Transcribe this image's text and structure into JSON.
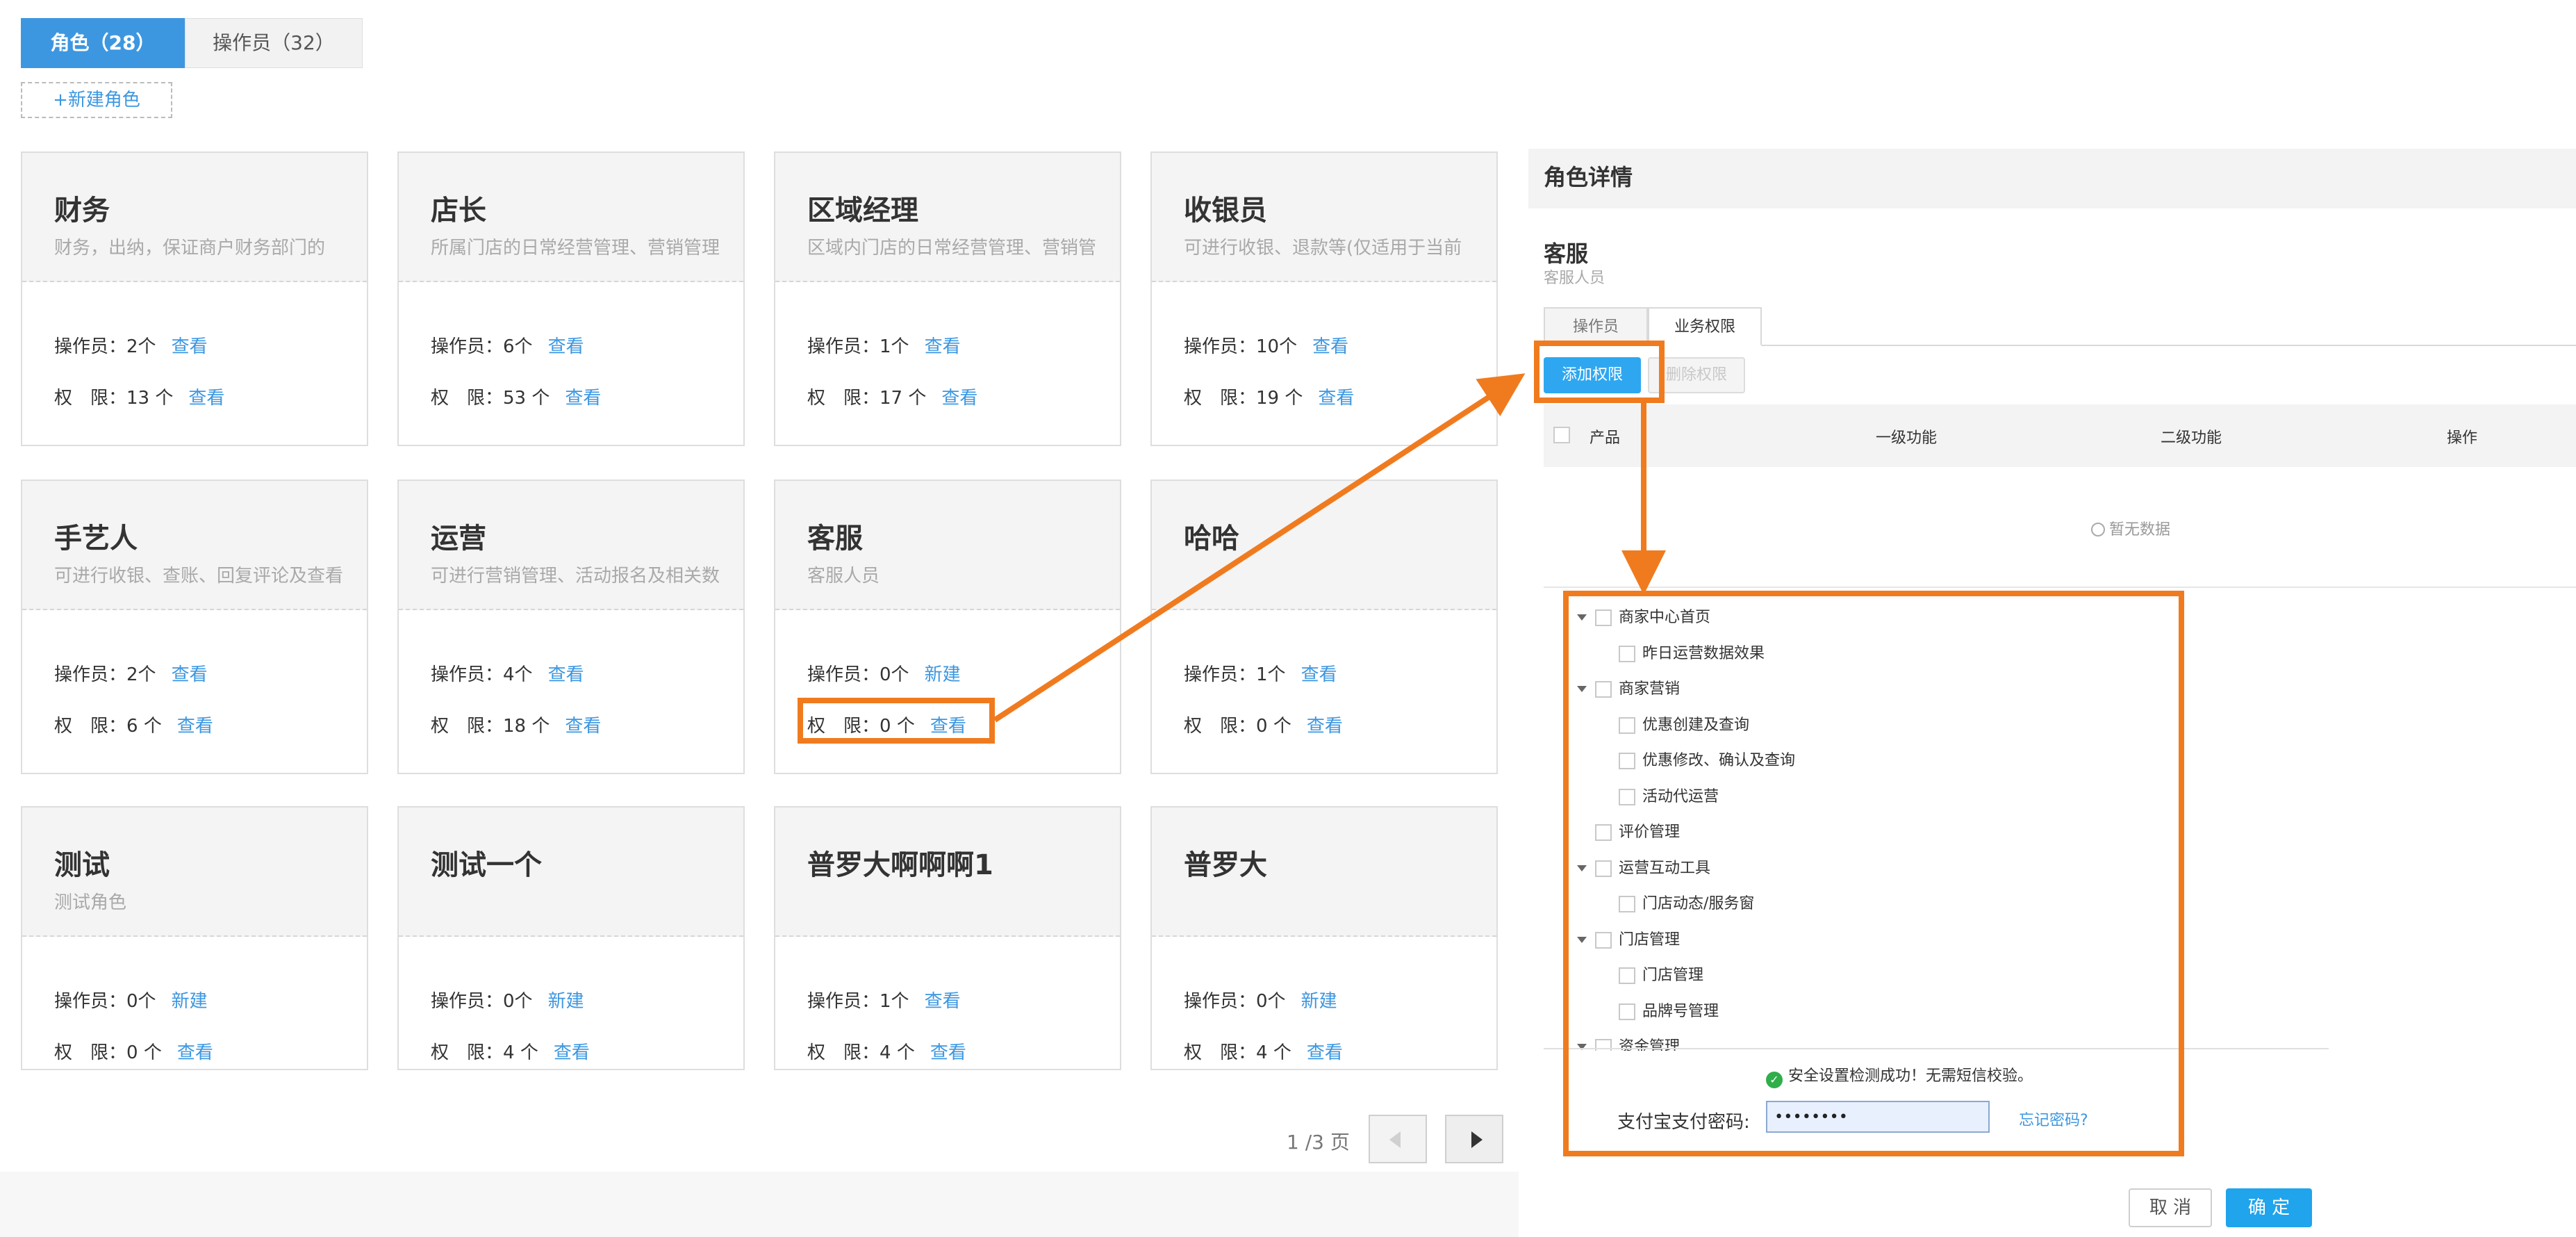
{
  "tabs": {
    "roles": "角色（28）",
    "operators": "操作员（32）"
  },
  "new_role_label": "+新建角色",
  "operator_label": "操作员：",
  "perm_label": "权　限：",
  "cards": [
    {
      "title": "财务",
      "desc": "财务，出纳，保证商户财务部门的",
      "op_count": "2个",
      "op_action": "查看",
      "perm_count": "13 个",
      "perm_action": "查看"
    },
    {
      "title": "店长",
      "desc": "所属门店的日常经营管理、营销管理",
      "op_count": "6个",
      "op_action": "查看",
      "perm_count": "53 个",
      "perm_action": "查看"
    },
    {
      "title": "区域经理",
      "desc": "区域内门店的日常经营管理、营销管",
      "op_count": "1个",
      "op_action": "查看",
      "perm_count": "17 个",
      "perm_action": "查看"
    },
    {
      "title": "收银员",
      "desc": "可进行收银、退款等(仅适用于当前",
      "op_count": "10个",
      "op_action": "查看",
      "perm_count": "19 个",
      "perm_action": "查看"
    },
    {
      "title": "手艺人",
      "desc": "可进行收银、查账、回复评论及查看",
      "op_count": "2个",
      "op_action": "查看",
      "perm_count": "6 个",
      "perm_action": "查看"
    },
    {
      "title": "运营",
      "desc": "可进行营销管理、活动报名及相关数",
      "op_count": "4个",
      "op_action": "查看",
      "perm_count": "18 个",
      "perm_action": "查看"
    },
    {
      "title": "客服",
      "desc": "客服人员",
      "op_count": "0个",
      "op_action": "新建",
      "perm_count": "0 个",
      "perm_action": "查看"
    },
    {
      "title": "哈哈",
      "desc": "",
      "op_count": "1个",
      "op_action": "查看",
      "perm_count": "0 个",
      "perm_action": "查看"
    },
    {
      "title": "测试",
      "desc": "测试角色",
      "op_count": "0个",
      "op_action": "新建",
      "perm_count": "0 个",
      "perm_action": "查看"
    },
    {
      "title": "测试一个",
      "desc": "",
      "op_count": "0个",
      "op_action": "新建",
      "perm_count": "4 个",
      "perm_action": "查看"
    },
    {
      "title": "普罗大啊啊啊1",
      "desc": "",
      "op_count": "1个",
      "op_action": "查看",
      "perm_count": "4 个",
      "perm_action": "查看"
    },
    {
      "title": "普罗大",
      "desc": "",
      "op_count": "0个",
      "op_action": "新建",
      "perm_count": "4 个",
      "perm_action": "查看"
    }
  ],
  "pagination": {
    "text": "1 /3 页"
  },
  "detail": {
    "title": "角色详情",
    "role_name": "客服",
    "role_desc": "客服人员",
    "tab_operators": "操作员",
    "tab_permissions": "业务权限",
    "btn_add": "添加权限",
    "btn_delete": "删除权限",
    "columns": [
      "产品",
      "一级功能",
      "二级功能",
      "操作"
    ],
    "empty": "暂无数据"
  },
  "tree": [
    {
      "label": "商家中心首页",
      "level": 1,
      "expanded": true
    },
    {
      "label": "昨日运营数据效果",
      "level": 2
    },
    {
      "label": "商家营销",
      "level": 1,
      "expanded": true
    },
    {
      "label": "优惠创建及查询",
      "level": 2
    },
    {
      "label": "优惠修改、确认及查询",
      "level": 2
    },
    {
      "label": "活动代运营",
      "level": 2
    },
    {
      "label": "评价管理",
      "level": 1,
      "expanded": false
    },
    {
      "label": "运营互动工具",
      "level": 1,
      "expanded": true
    },
    {
      "label": "门店动态/服务窗",
      "level": 2
    },
    {
      "label": "门店管理",
      "level": 1,
      "expanded": true
    },
    {
      "label": "门店管理",
      "level": 2
    },
    {
      "label": "品牌号管理",
      "level": 2
    },
    {
      "label": "资金管理",
      "level": 1,
      "expanded": true
    }
  ],
  "security": {
    "ok_text": "安全设置检测成功！无需短信校验。",
    "pwd_label": "支付宝支付密码:",
    "pwd_value": "••••••••",
    "forgot": "忘记密码?"
  },
  "footer": {
    "cancel": "取 消",
    "confirm": "确 定"
  },
  "colors": {
    "accent": "#3d97e0",
    "highlight": "#f07b1f",
    "primary_btn": "#20a4ec"
  }
}
